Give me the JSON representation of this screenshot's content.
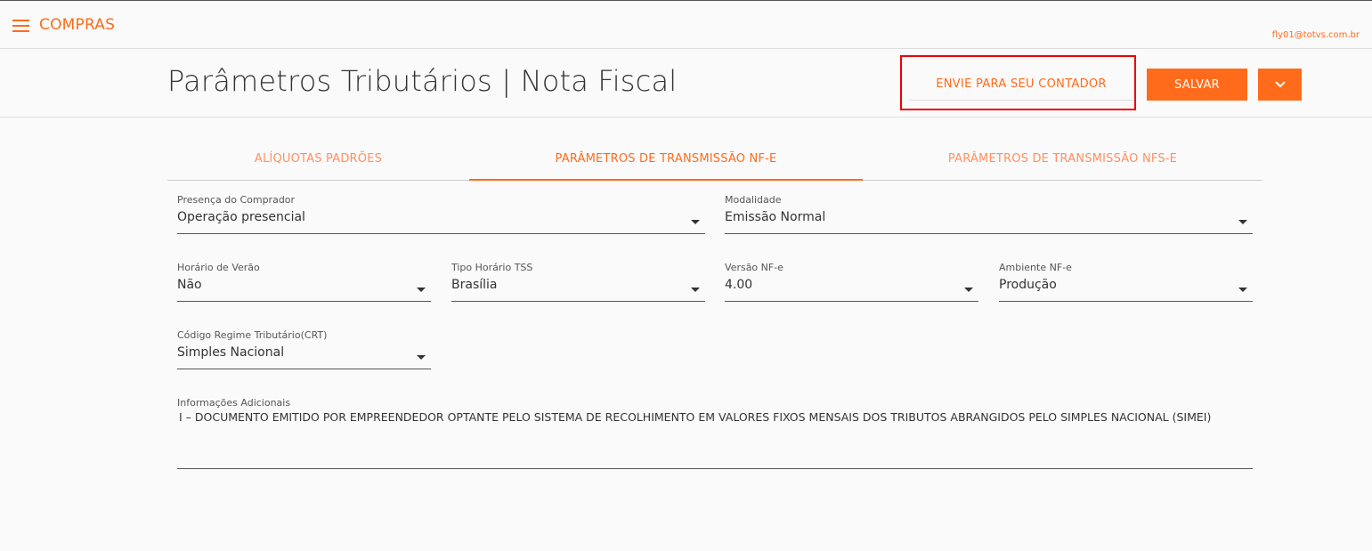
{
  "app": {
    "title": "COMPRAS",
    "user_email": "fly01@totvs.com.br"
  },
  "header": {
    "title": "Parâmetros Tributários | Nota Fiscal",
    "contador_label": "ENVIE PARA SEU CONTADOR",
    "save_label": "SALVAR"
  },
  "tabs": [
    {
      "label": "ALÍQUOTAS PADRÕES",
      "active": false
    },
    {
      "label": "PARÂMETROS DE TRANSMISSÃO NF-E",
      "active": true
    },
    {
      "label": "PARÂMETROS DE TRANSMISSÃO NFS-E",
      "active": false
    }
  ],
  "fields": {
    "presenca": {
      "label": "Presença do Comprador",
      "value": "Operação presencial"
    },
    "modalidade": {
      "label": "Modalidade",
      "value": "Emissão Normal"
    },
    "horario_verao": {
      "label": "Horário de Verão",
      "value": "Não"
    },
    "tipo_horario": {
      "label": "Tipo Horário TSS",
      "value": "Brasília"
    },
    "versao": {
      "label": "Versão NF-e",
      "value": "4.00"
    },
    "ambiente": {
      "label": "Ambiente NF-e",
      "value": "Produção"
    },
    "crt": {
      "label": "Código Regime Tributário(CRT)",
      "value": "Simples Nacional"
    },
    "info": {
      "label": "Informações Adicionais",
      "value": "I – DOCUMENTO EMITIDO POR EMPREENDEDOR OPTANTE PELO SISTEMA DE RECOLHIMENTO EM VALORES FIXOS MENSAIS DOS TRIBUTOS ABRANGIDOS PELO SIMPLES NACIONAL (SIMEI)"
    }
  },
  "colors": {
    "accent": "#ff6b1a",
    "highlight": "#ee0000"
  },
  "icons": {
    "menu": "hamburger-icon",
    "more": "chevron-down-icon",
    "select": "caret-down-icon"
  }
}
